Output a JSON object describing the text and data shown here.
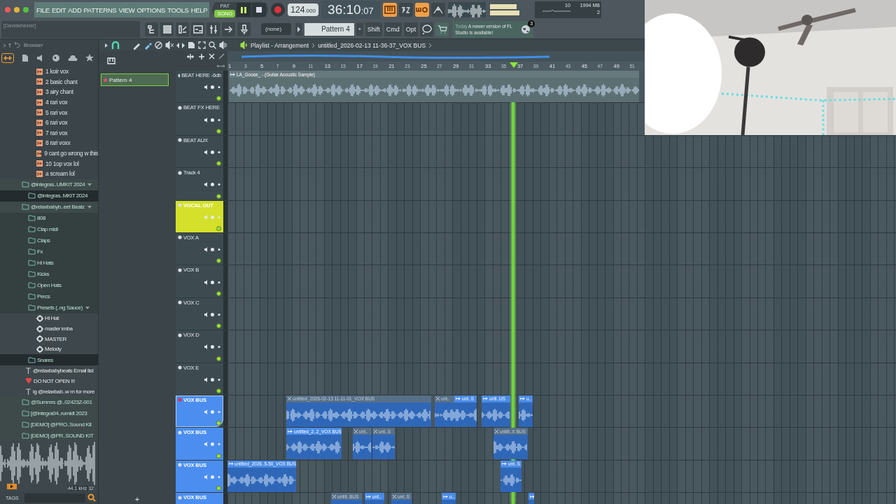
{
  "menu_bar": {
    "items": [
      "FILE",
      "EDIT",
      "ADD",
      "PATTERNS",
      "VIEW",
      "OPTIONS",
      "TOOLS",
      "HELP"
    ]
  },
  "transport": {
    "modes": [
      {
        "label": "PAT",
        "selected": false
      },
      {
        "label": "SONG",
        "selected": true
      }
    ],
    "tempo": "124",
    "tempo_decimals": ".000",
    "time": "36:10",
    "time_ticks": ":07",
    "cpu": "10",
    "memory": "1994 MB",
    "polyphony": "2"
  },
  "hint_bar": {
    "text": "[Davidwheeler]"
  },
  "toolbar": {
    "pattern_dropdown": "(none)",
    "pattern_selector": "Pattern 4",
    "add_pattern": "+",
    "modifier_keys": [
      "Shift",
      "Cmd",
      "Opt"
    ]
  },
  "news": {
    "label": "Today",
    "message": "A newer version of FL Studio is available!",
    "badge": "3"
  },
  "browser": {
    "title": "Browser",
    "files": [
      "1 koir vox",
      "2 basic chant",
      "3 airy chant",
      "4 rari vox",
      "5 rari vox",
      "6 rari vox",
      "7 rari vox",
      "8 rari voxx",
      "9 cant go wrong w this",
      "10 1op vox lol",
      "a scream lol"
    ],
    "tree": [
      {
        "kind": "folder",
        "name": "@integras..UMKIT 2024",
        "expanded": true,
        "selected": false,
        "children": [
          {
            "kind": "folder",
            "name": "@integras..MKIT 2024",
            "expanded": false,
            "selected": true
          }
        ]
      },
      {
        "kind": "folder",
        "name": "@relaxbabyb..eet Beatz",
        "expanded": true,
        "selected": false,
        "children": [
          {
            "kind": "folder",
            "name": "808",
            "expanded": false,
            "selected": false
          },
          {
            "kind": "folder",
            "name": "Clap midi",
            "expanded": false,
            "selected": false
          },
          {
            "kind": "folder",
            "name": "Claps",
            "expanded": false,
            "selected": false
          },
          {
            "kind": "folder",
            "name": "Fx",
            "expanded": false,
            "selected": false
          },
          {
            "kind": "folder",
            "name": "Hi Hats",
            "expanded": false,
            "selected": false
          },
          {
            "kind": "folder",
            "name": "Kicks",
            "expanded": false,
            "selected": false
          },
          {
            "kind": "folder",
            "name": "Open Hats",
            "expanded": false,
            "selected": false
          },
          {
            "kind": "folder",
            "name": "Percs",
            "expanded": false,
            "selected": false
          },
          {
            "kind": "folder",
            "name": "Presets (..ng Sauce)",
            "expanded": true,
            "selected": false,
            "children": [
              {
                "kind": "preset",
                "name": "Hi Hat",
                "selected": false
              },
              {
                "kind": "preset",
                "name": "master imba",
                "selected": false
              },
              {
                "kind": "preset",
                "name": "MASTER",
                "selected": false
              },
              {
                "kind": "preset",
                "name": "Melody",
                "selected": false
              }
            ]
          },
          {
            "kind": "folder",
            "name": "Snares",
            "expanded": false,
            "selected": true
          },
          {
            "kind": "text",
            "name": "@relaxbabybeats Email list",
            "selected": false
          },
          {
            "kind": "heart",
            "name": "DO NOT OPEN !!!",
            "selected": false
          },
          {
            "kind": "text",
            "name": "ig @relaxbab..w m for more",
            "selected": false
          }
        ]
      },
      {
        "kind": "folder",
        "name": "@Summrs @..02423Z-001",
        "expanded": false,
        "selected": false
      },
      {
        "kind": "folder",
        "name": "[@integra04..rumkit 2023",
        "expanded": false,
        "selected": false
      },
      {
        "kind": "folder",
        "name": "[DEMO] @PRO..Sound Kit",
        "expanded": false,
        "selected": false
      },
      {
        "kind": "folder",
        "name": "[DEMO] @PR..SOUND KIT",
        "expanded": false,
        "selected": false
      }
    ],
    "sample_info": "44.1 kHz 32",
    "tags_button": "TAGS"
  },
  "patterns": {
    "items": [
      {
        "name": "Pattern 4",
        "selected": true
      }
    ],
    "add": "+"
  },
  "playlist": {
    "title": "Playlist - Arrangement",
    "breadcrumb": "untitled_2026-02-13 11-36-37_VOX BUS",
    "ruler": [
      "1",
      "3",
      "5",
      "7",
      "9",
      "11",
      "13",
      "15",
      "17",
      "19",
      "21",
      "23",
      "25",
      "27",
      "29",
      "31",
      "33",
      "35",
      "37",
      "39",
      "41",
      "43",
      "45",
      "47",
      "49",
      "51"
    ],
    "tracks": [
      {
        "name": "BEAT HERE -6db",
        "color": "#3d4b51",
        "selected": false,
        "clips": [
          {
            "name": "LA_Goose_ - (Guitar Acoustic Sample)",
            "muted": false
          }
        ]
      },
      {
        "name": "BEAT FX HERE",
        "color": "#3d4b51",
        "selected": false
      },
      {
        "name": "BEAT AUX",
        "color": "#3d4b51",
        "selected": false
      },
      {
        "name": "Track 4",
        "color": "#3d4b51",
        "selected": false
      },
      {
        "name": "VOCAL OUT",
        "color": "#d4e02a",
        "selected": false
      },
      {
        "name": "VOX A",
        "color": "#3d4b51",
        "selected": false
      },
      {
        "name": "VOX B",
        "color": "#3d4b51",
        "selected": false
      },
      {
        "name": "VOX C",
        "color": "#3d4b51",
        "selected": false
      },
      {
        "name": "VOX D",
        "color": "#3d4b51",
        "selected": false
      },
      {
        "name": "VOX E",
        "color": "#3d4b51",
        "selected": false
      },
      {
        "name": "VOX BUS",
        "color": "#4b8ef0",
        "selected": true,
        "clips": [
          {
            "name": "untitled_2026-02-13 11-11-01_VOX BUS",
            "muted": true
          },
          {
            "name": "unt..",
            "muted": true
          },
          {
            "name": "unt..S",
            "muted": false
          },
          {
            "name": "unti..US",
            "muted": false
          },
          {
            "name": "u..",
            "muted": false
          }
        ]
      },
      {
        "name": "VOX BUS",
        "color": "#4b8ef0",
        "selected": false,
        "clips": [
          {
            "name": "untitled_2..2_VOX BUS",
            "muted": false
          },
          {
            "name": "unt..",
            "muted": true
          },
          {
            "name": "unt..S",
            "muted": true
          },
          {
            "name": "untitl..X BUS",
            "muted": true
          }
        ]
      },
      {
        "name": "VOX BUS",
        "color": "#4b8ef0",
        "selected": false,
        "clips": [
          {
            "name": "untitled_2026..5-50_VOX BUS",
            "muted": false
          },
          {
            "name": "unt..S",
            "muted": false
          }
        ]
      },
      {
        "name": "VOX BUS",
        "color": "#4b8ef0",
        "selected": false,
        "clips": [
          {
            "name": "untitl..BUS",
            "muted": true
          },
          {
            "name": "unt..",
            "muted": false
          },
          {
            "name": "unt..S",
            "muted": true
          },
          {
            "name": "u..",
            "muted": false
          },
          {
            "muted": false
          }
        ]
      }
    ]
  }
}
